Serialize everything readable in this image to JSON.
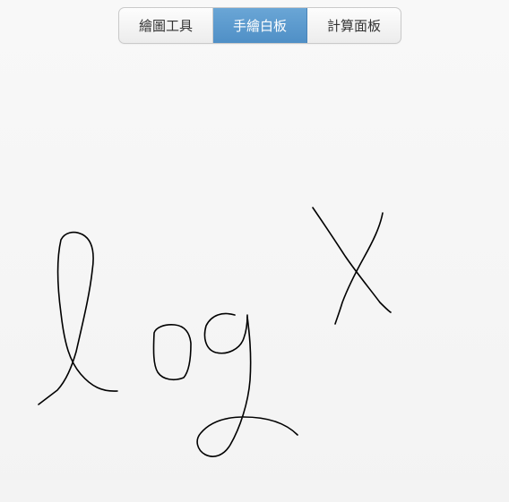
{
  "segmented_control": {
    "tabs": [
      {
        "label": "繪圖工具",
        "active": false
      },
      {
        "label": "手繪白板",
        "active": true
      },
      {
        "label": "計算面板",
        "active": false
      }
    ]
  },
  "colors": {
    "active_tab": "#5b9bd0",
    "ink": "#000000",
    "background": "#f5f5f5"
  }
}
